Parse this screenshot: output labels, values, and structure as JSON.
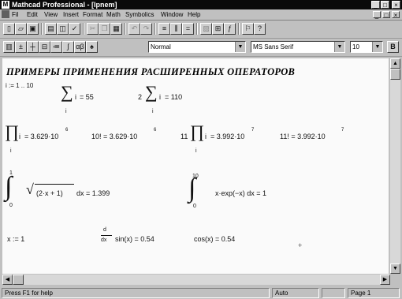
{
  "window": {
    "title": "Mathcad Professional - [Ipnem]",
    "controls": [
      "_",
      "□",
      "×"
    ]
  },
  "menu": {
    "items": [
      "Fil",
      "Edit",
      "View",
      "Insert",
      "Format",
      "Math",
      "Symbolics",
      "Window",
      "Help"
    ]
  },
  "toolbar": {
    "style_value": "Normal",
    "font_value": "MS Sans Serif",
    "size_value": "10"
  },
  "document": {
    "heading": "ПРИМЕРЫ ПРИМЕНЕНИЯ РАСШИРЕННЫХ ОПЕРАТОРОВ",
    "range_def": "i := 1 .. 10",
    "sum1": "= 55",
    "sum2_coef": "2",
    "sum2": "= 110",
    "prod_result": "= 3.629·10",
    "prod_exp": "6",
    "fact_expr": "10! = 3.629·10",
    "fact_exp": "6",
    "prod2_coef": "11",
    "prod2_result": "= 3.992·10",
    "prod2_exp": "7",
    "fact2_expr": "11! = 3.992·10",
    "fact2_exp": "7",
    "int1_upper": "1",
    "int1_lower": "0",
    "int1_body": "(2·x + 1)",
    "int1_dx": "dx = 1.399",
    "int2_upper": "10",
    "int2_lower": "0",
    "int2_body": "x·exp(−x) dx = 1",
    "xdef": "x := 1",
    "deriv_num": "d",
    "deriv_den": "dx",
    "deriv_body": "sin(x) = 0.54",
    "cos_expr": "cos(x) = 0.54",
    "sum_var": "i",
    "sum_idx": "i"
  },
  "status": {
    "help": "Press F1 for help",
    "mode": "Auto",
    "page": "Page 1"
  }
}
